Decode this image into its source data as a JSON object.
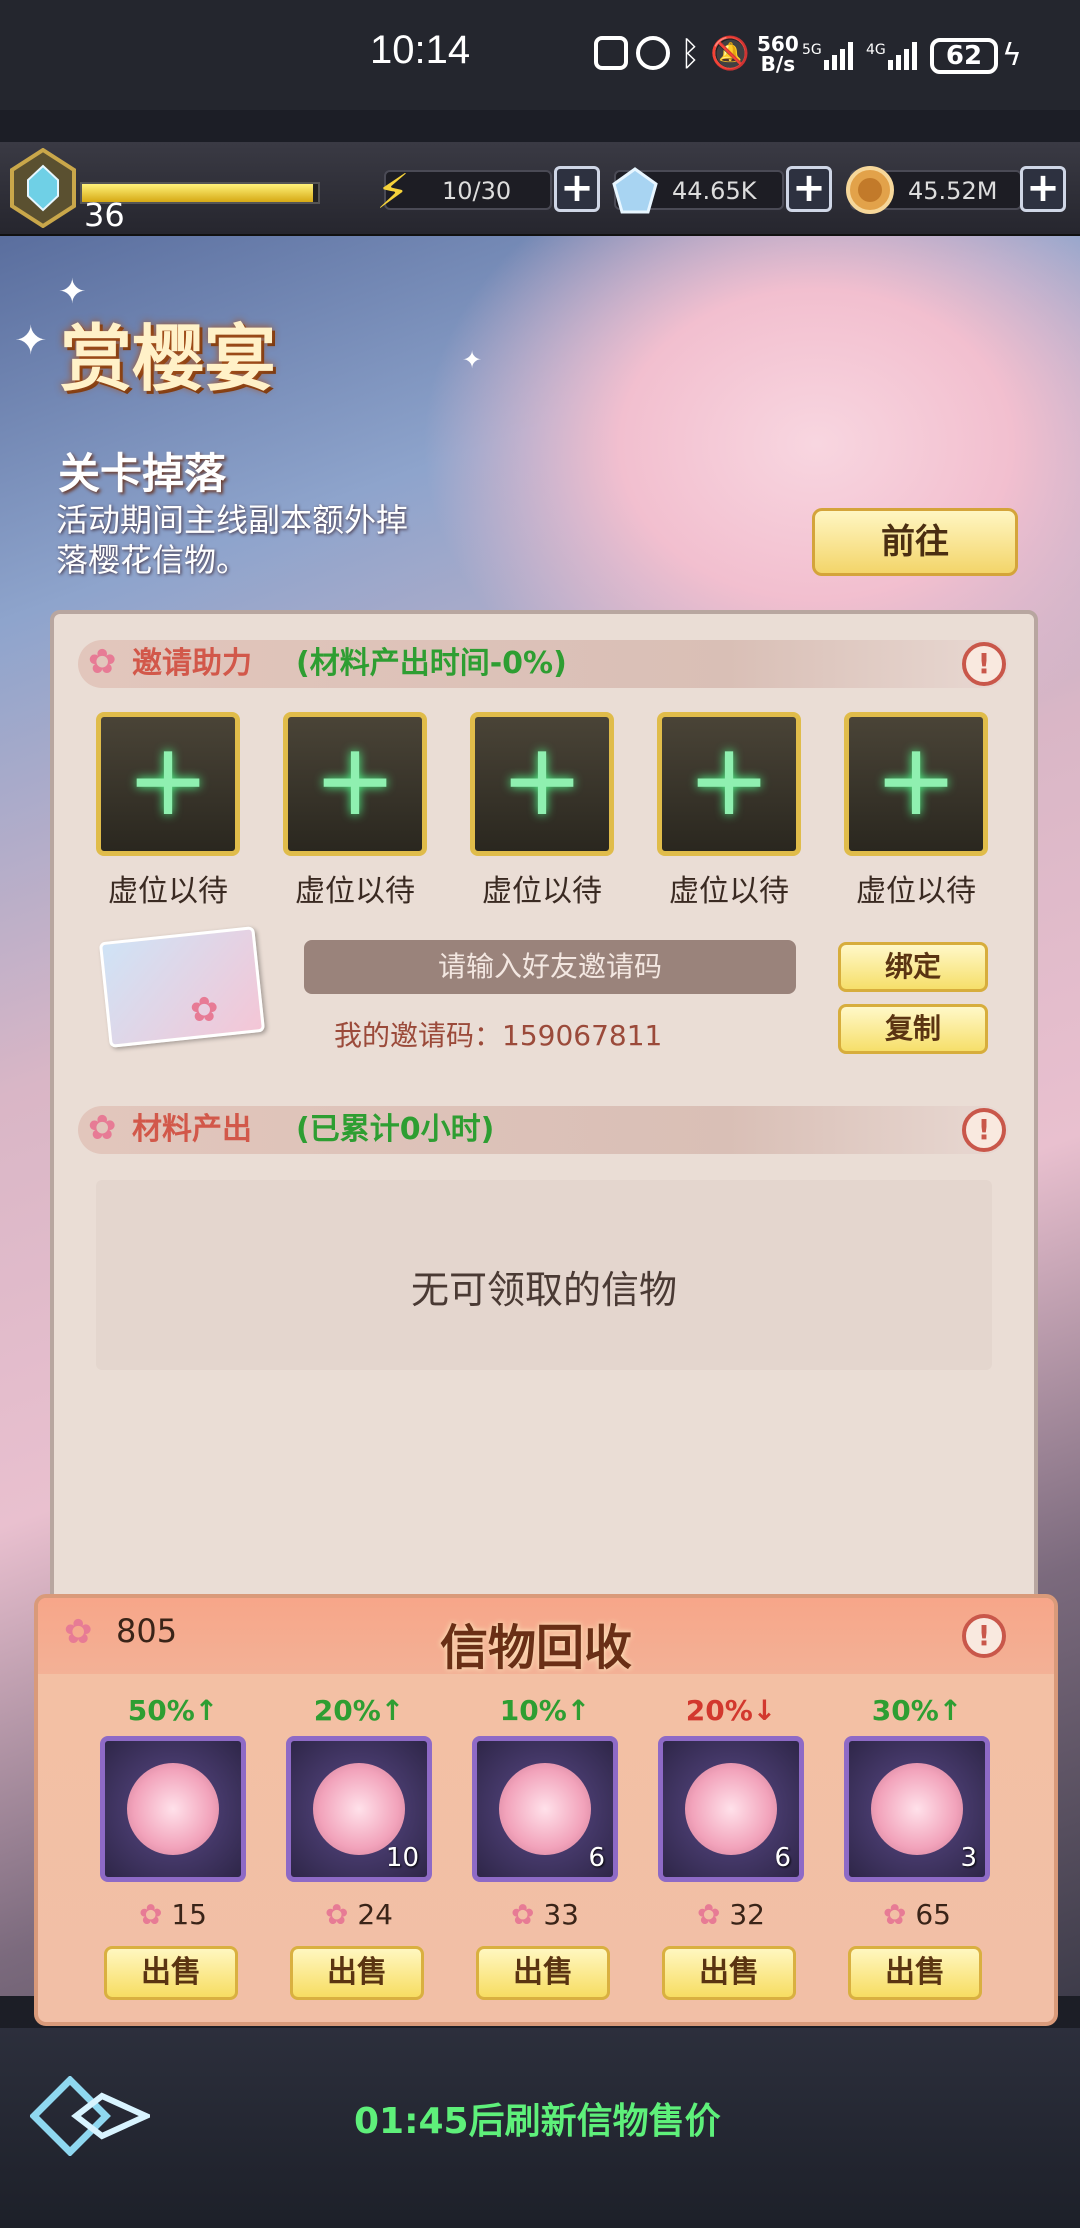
{
  "status_bar": {
    "time": "10:14",
    "speed_top": "560",
    "speed_bottom": "B/s",
    "battery": "62"
  },
  "resources": {
    "level": "36",
    "xp_fraction": 0.98,
    "energy": "10/30",
    "gems": "44.65K",
    "coins": "45.52M"
  },
  "banner": {
    "title": "赏樱宴",
    "drop_title": "关卡掉落",
    "drop_desc": "活动期间主线副本额外掉落樱花信物。",
    "goto_label": "前往"
  },
  "invite": {
    "section_title": "邀请助力",
    "section_sub": "(材料产出时间-0%)",
    "slots": [
      "虚位以待",
      "虚位以待",
      "虚位以待",
      "虚位以待",
      "虚位以待"
    ],
    "input_placeholder": "请输入好友邀请码",
    "my_code": "我的邀请码：159067811",
    "bind_label": "绑定",
    "copy_label": "复制"
  },
  "materials": {
    "section_title": "材料产出",
    "section_sub": "(已累计0小时)",
    "empty_text": "无可领取的信物"
  },
  "recycle": {
    "title": "信物回收",
    "sakura_total": "805",
    "items": [
      {
        "pct": "50%↑",
        "pct_color": "#2e9e32",
        "count": "",
        "price": "15",
        "sell": "出售"
      },
      {
        "pct": "20%↑",
        "pct_color": "#2e9e32",
        "count": "10",
        "price": "24",
        "sell": "出售"
      },
      {
        "pct": "10%↑",
        "pct_color": "#2e9e32",
        "count": "6",
        "price": "33",
        "sell": "出售"
      },
      {
        "pct": "20%↓",
        "pct_color": "#d2382e",
        "count": "6",
        "price": "32",
        "sell": "出售"
      },
      {
        "pct": "30%↑",
        "pct_color": "#2e9e32",
        "count": "3",
        "price": "65",
        "sell": "出售"
      }
    ]
  },
  "footer": {
    "refresh_text": "01:45后刷新信物售价"
  },
  "icons": {
    "plus": "+",
    "info": "!",
    "sakura": "✿",
    "sparkle": "✦"
  }
}
